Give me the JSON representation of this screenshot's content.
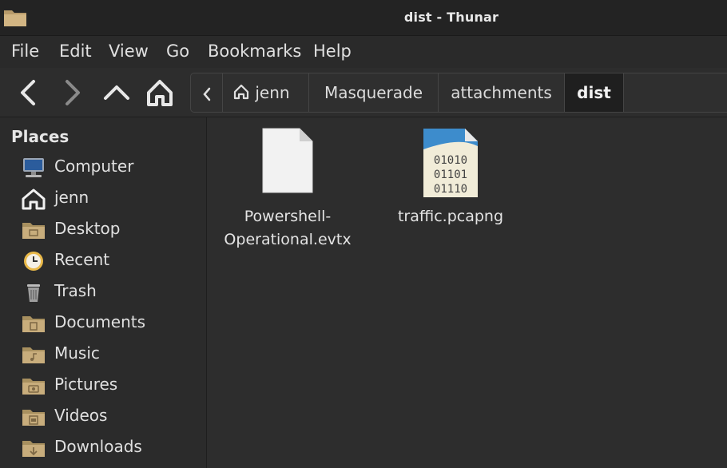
{
  "window": {
    "title": "dist - Thunar"
  },
  "menubar": {
    "items": [
      "File",
      "Edit",
      "View",
      "Go",
      "Bookmarks",
      "Help"
    ]
  },
  "pathbar": {
    "crumbs": [
      "jenn",
      "Masquerade",
      "attachments",
      "dist"
    ]
  },
  "sidebar": {
    "heading": "Places",
    "items": [
      {
        "label": "Computer",
        "icon": "computer-icon"
      },
      {
        "label": "jenn",
        "icon": "home-icon"
      },
      {
        "label": "Desktop",
        "icon": "desktop-folder-icon"
      },
      {
        "label": "Recent",
        "icon": "recent-clock-icon"
      },
      {
        "label": "Trash",
        "icon": "trash-icon"
      },
      {
        "label": "Documents",
        "icon": "documents-folder-icon"
      },
      {
        "label": "Music",
        "icon": "music-folder-icon"
      },
      {
        "label": "Pictures",
        "icon": "pictures-folder-icon"
      },
      {
        "label": "Videos",
        "icon": "videos-folder-icon"
      },
      {
        "label": "Downloads",
        "icon": "downloads-folder-icon"
      }
    ]
  },
  "files": [
    {
      "name_line1": "Powershell-",
      "name_line2": "Operational.evtx",
      "icon": "blank-file-icon"
    },
    {
      "name": "traffic.pcapng",
      "icon": "binary-file-icon",
      "binary_lines": [
        "01010",
        "01101",
        "01110"
      ]
    }
  ]
}
